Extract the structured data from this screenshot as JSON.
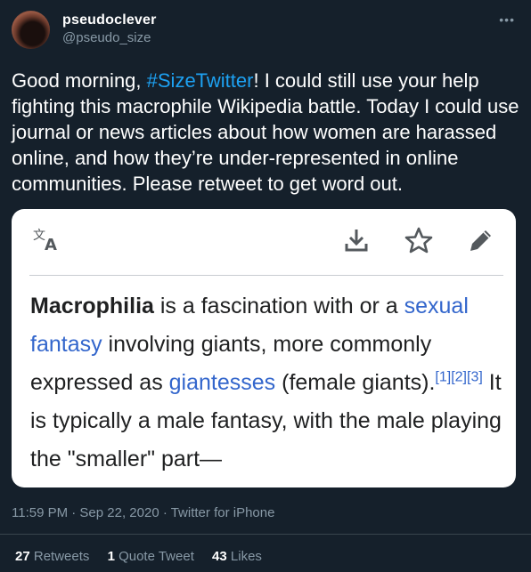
{
  "author": {
    "display_name": "pseudoclever",
    "handle": "@pseudo_size"
  },
  "more_icon": "more-horizontal-icon",
  "tweet": {
    "text_before": "Good morning, ",
    "hashtag": "#SizeTwitter",
    "text_after": "! I could still use your help fighting this macrophile Wikipedia battle. Today I could use journal or news articles about how women are harassed online, and how they’re under-represented in online communities. Please retweet to get word out."
  },
  "card": {
    "icons": [
      "translate-icon",
      "download-icon",
      "star-icon",
      "edit-pencil-icon"
    ],
    "term": "Macrophilia",
    "seg1": " is a fascination with or a ",
    "link1": "sexual fantasy",
    "seg2": " involving giants, more commonly expressed as ",
    "link2": "giantesses",
    "seg3": " (female giants).",
    "citations": "[1][2][3]",
    "seg4": " It is typically a male fantasy, with the male playing the \"smaller\" part—"
  },
  "meta": "11:59 PM · Sep 22, 2020 · Twitter for iPhone",
  "stats": {
    "retweets_count": "27",
    "retweets_label": "Retweets",
    "quotes_count": "1",
    "quotes_label": "Quote Tweet",
    "likes_count": "43",
    "likes_label": "Likes"
  },
  "colors": {
    "background": "#15202b",
    "accent": "#1da1f2",
    "muted": "#8899a6",
    "wiki_link": "#3366cc"
  }
}
